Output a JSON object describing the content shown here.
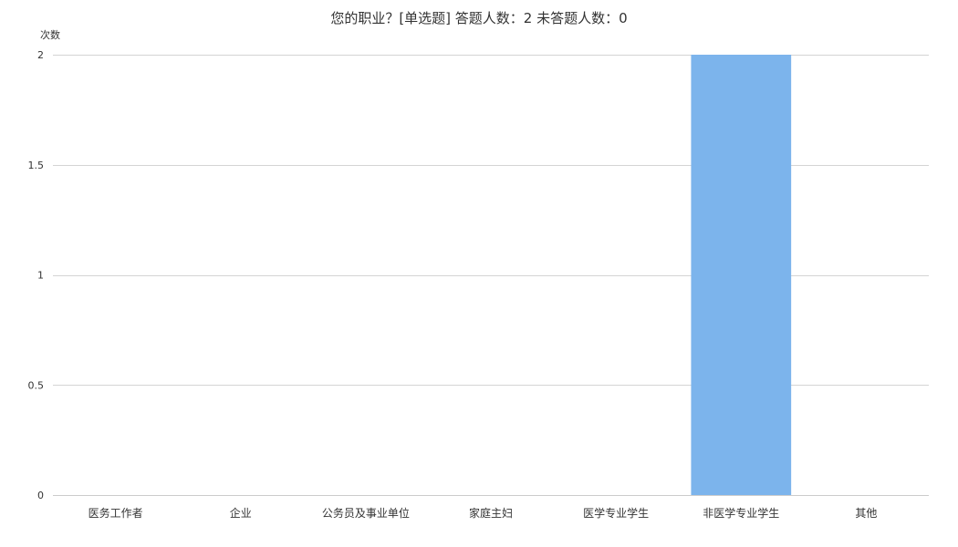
{
  "title": "您的职业？[单选题]  答题人数：2  未答题人数：0",
  "chart_data": {
    "type": "bar",
    "title": "您的职业？[单选题]  答题人数：2  未答题人数：0",
    "ylabel": "次数",
    "xlabel": "",
    "categories": [
      "医务工作者",
      "企业",
      "公务员及事业单位",
      "家庭主妇",
      "医学专业学生",
      "非医学专业学生",
      "其他"
    ],
    "values": [
      0,
      0,
      0,
      0,
      0,
      2,
      0
    ],
    "ylim": [
      0,
      2
    ],
    "yticks": [
      0,
      0.5,
      1,
      1.5,
      2
    ],
    "ytick_labels": [
      "0",
      "0.5",
      "1",
      "1.5",
      "2"
    ],
    "grid": true,
    "legend": "none",
    "colors": {
      "bar": "#7cb4ec",
      "grid": "#d4d4d4",
      "axis": "#cccccc",
      "text": "#333333"
    }
  }
}
